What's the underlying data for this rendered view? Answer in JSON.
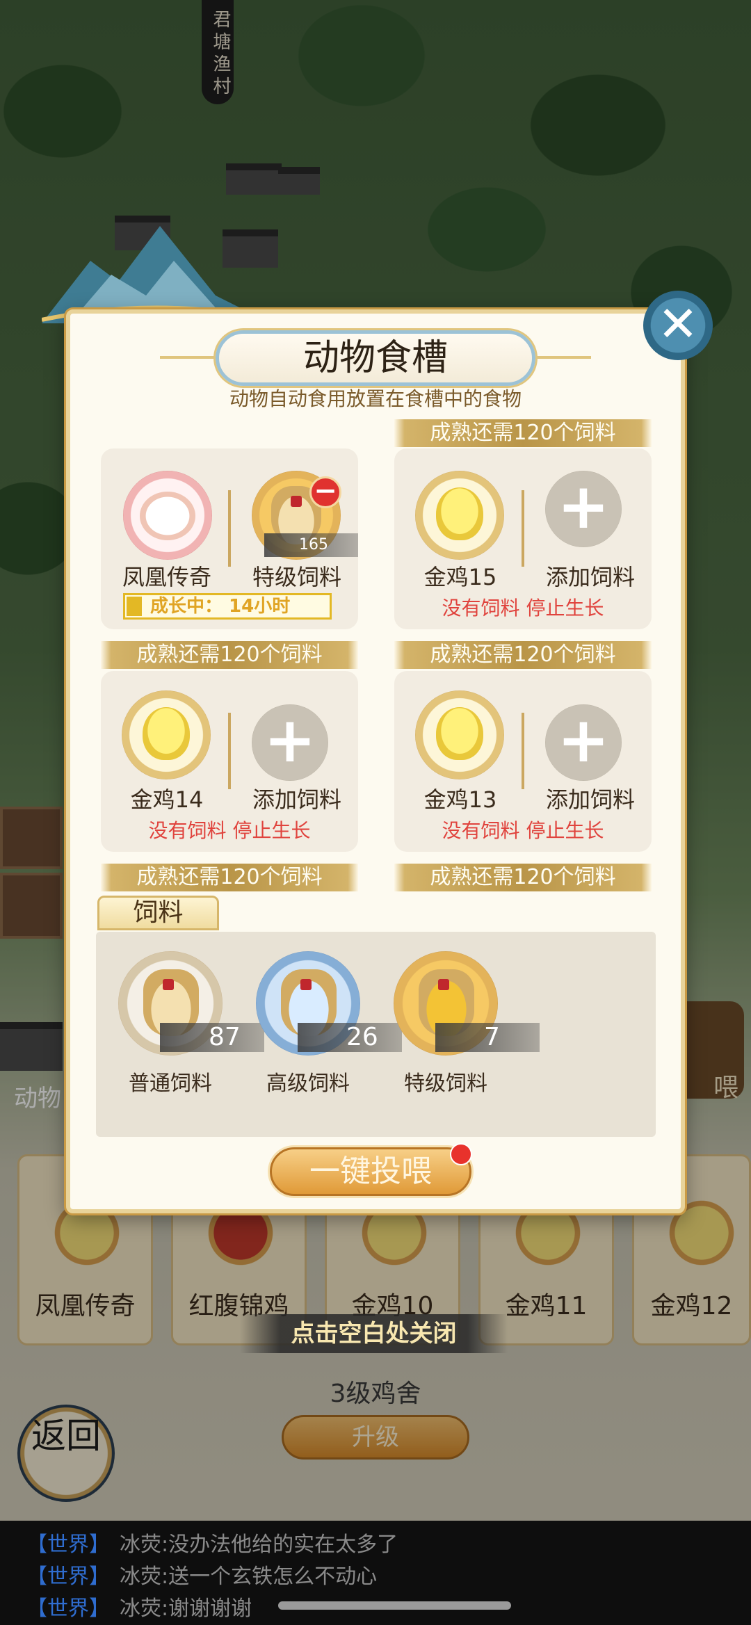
{
  "background": {
    "village_sign": "君塘渔村",
    "side_button_text": "动物",
    "side_feed_button": "喂",
    "bottom_animals": [
      "凤凰传奇",
      "红腹锦鸡",
      "金鸡10",
      "金鸡11",
      "金鸡12"
    ],
    "coop_level": "3级鸡舍",
    "upgrade_label": "升级",
    "back_label": "返回"
  },
  "dialog": {
    "title": "动物食槽",
    "subtitle": "动物自动食用放置在食槽中的食物",
    "close_icon": "close-x-icon",
    "slots": [
      {
        "animal": "凤凰传奇",
        "feed_label": "特级饲料",
        "feed_count": "165",
        "status": "成长中： 14小时",
        "ribbon": "成熟还需120个饲料"
      },
      {
        "animal": "金鸡15",
        "feed_label": "添加饲料",
        "status": "没有饲料 停止生长",
        "ribbon_top": "成熟还需120个饲料",
        "ribbon": "成熟还需120个饲料"
      },
      {
        "animal": "金鸡14",
        "feed_label": "添加饲料",
        "status": "没有饲料 停止生长",
        "ribbon_top": "成熟还需120个饲料",
        "ribbon": "成熟还需120个饲料"
      },
      {
        "animal": "金鸡13",
        "feed_label": "添加饲料",
        "status": "没有饲料 停止生长",
        "ribbon_top": "成熟还需120个饲料",
        "ribbon": "成熟还需120个饲料"
      }
    ],
    "feed_section": {
      "tab": "饲料",
      "items": [
        {
          "label": "普通饲料",
          "count": "87"
        },
        {
          "label": "高级饲料",
          "count": "26"
        },
        {
          "label": "特级饲料",
          "count": "7"
        }
      ]
    },
    "feed_all_button": "一键投喂"
  },
  "close_hint": "点击空白处关闭",
  "chat": [
    {
      "channel": "【世界】",
      "user": "冰荧:",
      "message": "没办法他给的实在太多了"
    },
    {
      "channel": "【世界】",
      "user": "冰荧:",
      "message": "送一个玄铁怎么不动心"
    },
    {
      "channel": "【世界】",
      "user": "冰荧:",
      "message": "谢谢谢谢"
    }
  ],
  "colors": {
    "ribbon_gold": "#b99548",
    "warning_red": "#e0433d",
    "growth_yellow": "#e3b825",
    "chat_channel_blue": "#2f6dd0"
  }
}
